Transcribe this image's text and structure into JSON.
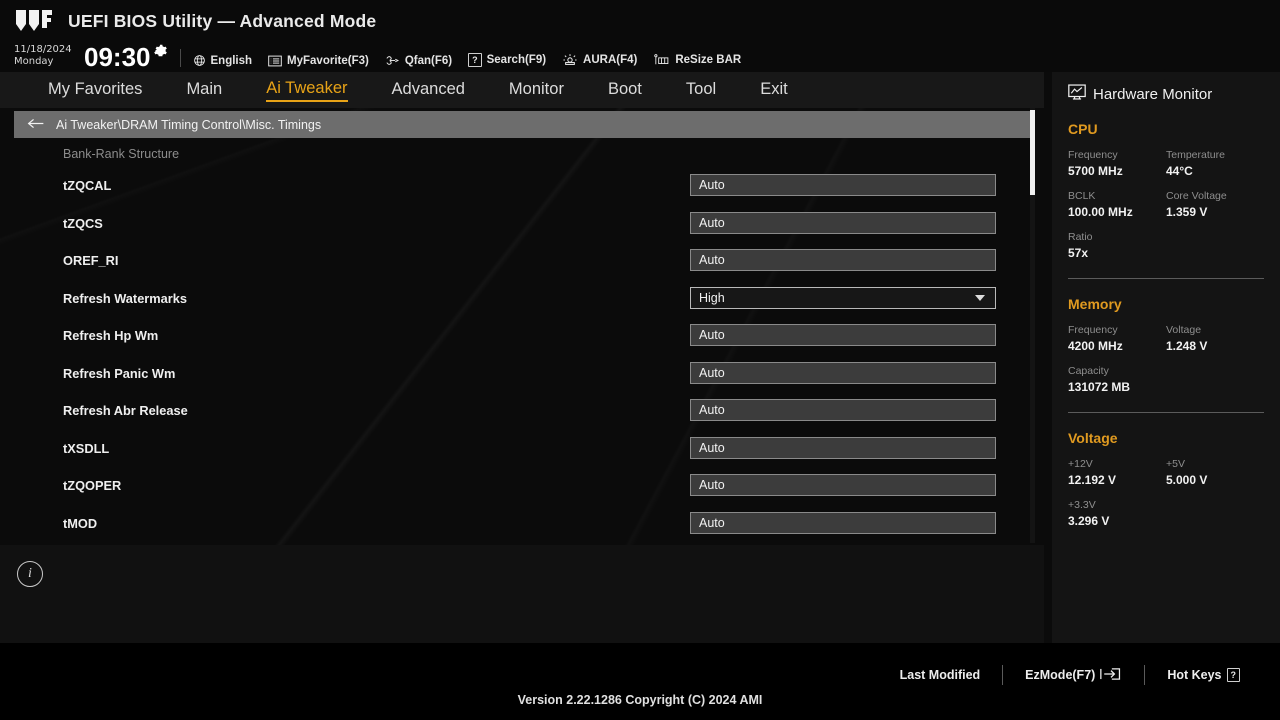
{
  "header": {
    "logo": "tuf-gaming-logo",
    "title": "UEFI BIOS Utility — Advanced Mode",
    "date": "11/18/2024",
    "weekday": "Monday",
    "time": "09:30",
    "gear_icon": "gear-icon",
    "tools": [
      {
        "icon": "globe-icon",
        "label": "English"
      },
      {
        "icon": "list-icon",
        "label": "MyFavorite(F3)"
      },
      {
        "icon": "fan-icon",
        "label": "Qfan(F6)"
      },
      {
        "icon": "question-box-icon",
        "label": "Search(F9)"
      },
      {
        "icon": "aura-light-icon",
        "label": "AURA(F4)"
      },
      {
        "icon": "resize-bar-icon",
        "label": "ReSize BAR"
      }
    ]
  },
  "menu": {
    "items": [
      {
        "label": "My Favorites",
        "active": false
      },
      {
        "label": "Main",
        "active": false
      },
      {
        "label": "Ai Tweaker",
        "active": true
      },
      {
        "label": "Advanced",
        "active": false
      },
      {
        "label": "Monitor",
        "active": false
      },
      {
        "label": "Boot",
        "active": false
      },
      {
        "label": "Tool",
        "active": false
      },
      {
        "label": "Exit",
        "active": false
      }
    ],
    "active_color": "#e8a317"
  },
  "breadcrumb": {
    "back_icon": "arrow-left-icon",
    "path": "Ai Tweaker\\DRAM Timing Control\\Misc. Timings"
  },
  "content": {
    "section_heading": "Bank-Rank Structure",
    "rows": [
      {
        "label": "tZQCAL",
        "value": "Auto",
        "type": "text"
      },
      {
        "label": "tZQCS",
        "value": "Auto",
        "type": "text"
      },
      {
        "label": "OREF_RI",
        "value": "Auto",
        "type": "text"
      },
      {
        "label": "Refresh Watermarks",
        "value": "High",
        "type": "select"
      },
      {
        "label": "Refresh Hp Wm",
        "value": "Auto",
        "type": "text"
      },
      {
        "label": "Refresh Panic Wm",
        "value": "Auto",
        "type": "text"
      },
      {
        "label": "Refresh Abr Release",
        "value": "Auto",
        "type": "text"
      },
      {
        "label": "tXSDLL",
        "value": "Auto",
        "type": "text"
      },
      {
        "label": "tZQOPER",
        "value": "Auto",
        "type": "text"
      },
      {
        "label": "tMOD",
        "value": "Auto",
        "type": "text"
      }
    ]
  },
  "help_panel": {
    "info_icon": "info-circle-icon",
    "text": ""
  },
  "hardware_monitor": {
    "icon": "monitor-icon",
    "title": "Hardware Monitor",
    "groups": [
      {
        "name": "CPU",
        "rows": [
          [
            {
              "key": "Frequency",
              "value": "5700 MHz"
            },
            {
              "key": "Temperature",
              "value": "44°C"
            }
          ],
          [
            {
              "key": "BCLK",
              "value": "100.00 MHz"
            },
            {
              "key": "Core Voltage",
              "value": "1.359 V"
            }
          ],
          [
            {
              "key": "Ratio",
              "value": "57x"
            }
          ]
        ]
      },
      {
        "name": "Memory",
        "rows": [
          [
            {
              "key": "Frequency",
              "value": "4200 MHz"
            },
            {
              "key": "Voltage",
              "value": "1.248 V"
            }
          ],
          [
            {
              "key": "Capacity",
              "value": "131072 MB"
            }
          ]
        ]
      },
      {
        "name": "Voltage",
        "rows": [
          [
            {
              "key": "+12V",
              "value": "12.192 V"
            },
            {
              "key": "+5V",
              "value": "5.000 V"
            }
          ],
          [
            {
              "key": "+3.3V",
              "value": "3.296 V"
            }
          ]
        ]
      }
    ],
    "group_color": "#e09a20"
  },
  "footer": {
    "last_modified": "Last Modified",
    "ez_mode": "EzMode(F7)",
    "ez_mode_icon": "arrow-into-box-icon",
    "hot_keys": "Hot Keys",
    "hot_keys_badge": "?",
    "version": "Version 2.22.1286 Copyright (C) 2024 AMI"
  }
}
